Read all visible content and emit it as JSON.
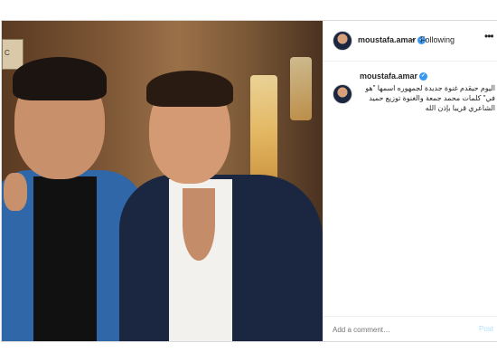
{
  "header": {
    "username": "moustafa.amar",
    "separator": "•",
    "follow_status": "Following",
    "more_icon": "more-options-icon"
  },
  "photo": {
    "sign_text": "C"
  },
  "caption": {
    "username": "moustafa.amar",
    "text": "اليوم حيقدم غنوة جديدة لجمهوره اسمها \"هو في\" كلمات محمد جمعة والغنوة توزيع حميد الشاعري قريبا بإذن الله"
  },
  "comment": {
    "placeholder": "Add a comment…",
    "post_label": "Post"
  },
  "colors": {
    "verified": "#3897f0",
    "post_disabled": "#b2dffc"
  }
}
